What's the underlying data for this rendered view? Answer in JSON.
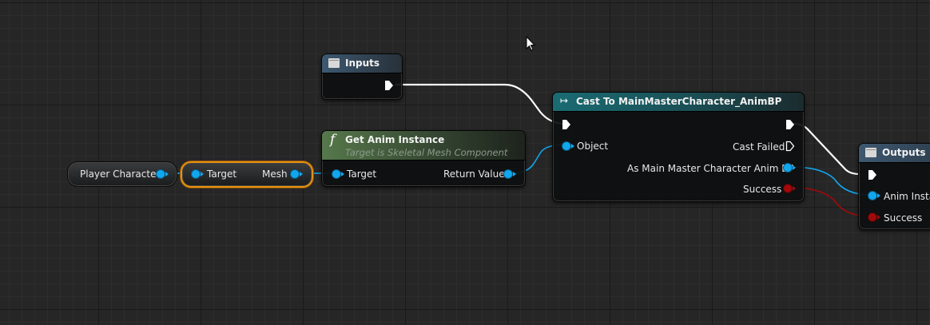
{
  "nodes": {
    "inputs": {
      "title": "Inputs"
    },
    "get_anim_instance": {
      "title": "Get Anim Instance",
      "subtitle": "Target is Skeletal Mesh Component",
      "target_label": "Target",
      "return_label": "Return Value"
    },
    "player_character": {
      "label": "Player Character"
    },
    "mesh_getter": {
      "target_label": "Target",
      "mesh_label": "Mesh"
    },
    "cast": {
      "title": "Cast To MainMasterCharacter_AnimBP",
      "object_label": "Object",
      "cast_failed_label": "Cast Failed",
      "as_label": "As Main Master Character Anim BP",
      "success_label": "Success"
    },
    "outputs": {
      "title": "Outputs",
      "anim_instance_label": "Anim Insta",
      "success_label": "Success"
    }
  },
  "colors": {
    "grid_bg": "#262626",
    "object_pin": "#10a7ef",
    "bool_pin": "#a00a0a",
    "exec_wire": "#ffffff",
    "cast_header": "#1a6b73",
    "func_header": "#56784b",
    "io_header": "#3d5870",
    "selection": "#e8920f"
  },
  "icons": {
    "inputs": "tunnel-box-icon",
    "get_anim_instance": "function-f-icon",
    "cast": "cast-arrow-icon",
    "outputs": "tunnel-box-icon"
  }
}
